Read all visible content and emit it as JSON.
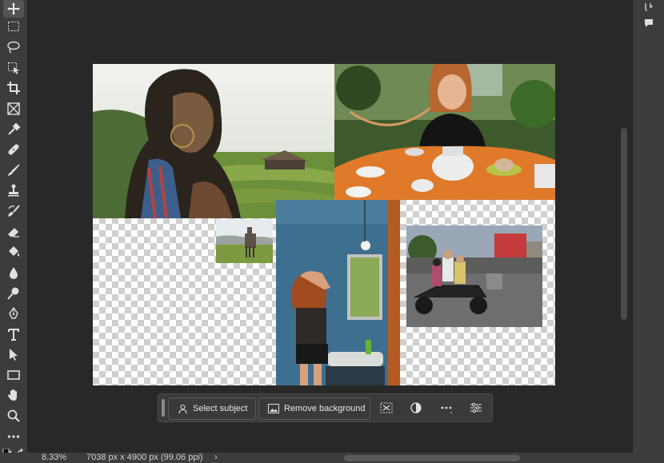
{
  "tools": [
    {
      "name": "move-tool",
      "icon": "move-icon",
      "active": true
    },
    {
      "name": "marquee-tool",
      "icon": "rectangular-marquee-icon"
    },
    {
      "name": "lasso-tool",
      "icon": "lasso-icon"
    },
    {
      "name": "object-selection-tool",
      "icon": "object-selection-icon"
    },
    {
      "name": "crop-tool",
      "icon": "crop-icon"
    },
    {
      "name": "frame-tool",
      "icon": "frame-icon"
    },
    {
      "name": "eyedropper-tool",
      "icon": "eyedropper-icon"
    },
    {
      "name": "healing-brush-tool",
      "icon": "bandage-icon"
    },
    {
      "name": "brush-tool",
      "icon": "brush-icon"
    },
    {
      "name": "clone-stamp-tool",
      "icon": "stamp-icon"
    },
    {
      "name": "history-brush-tool",
      "icon": "history-brush-icon"
    },
    {
      "name": "eraser-tool",
      "icon": "eraser-icon"
    },
    {
      "name": "paint-bucket-tool",
      "icon": "paint-bucket-icon"
    },
    {
      "name": "blur-tool",
      "icon": "drop-icon"
    },
    {
      "name": "dodge-tool",
      "icon": "dodge-icon"
    },
    {
      "name": "pen-tool",
      "icon": "pen-icon"
    },
    {
      "name": "type-tool",
      "icon": "type-icon"
    },
    {
      "name": "path-selection-tool",
      "icon": "arrow-icon"
    },
    {
      "name": "rectangle-tool",
      "icon": "rectangle-icon"
    },
    {
      "name": "hand-tool",
      "icon": "hand-icon"
    },
    {
      "name": "zoom-tool",
      "icon": "zoom-icon"
    },
    {
      "name": "more-tools",
      "icon": "more-icon"
    }
  ],
  "context_bar": {
    "select_subject": "Select subject",
    "remove_background": "Remove background"
  },
  "status": {
    "zoom": "8.33%",
    "doc_info": "7038 px x 4900 px (99.06 ppi)",
    "arrow": "›"
  },
  "colors": {
    "ui_background": "#282828",
    "panel": "#3c3c3c",
    "transparency_checker": "#cfcfcf",
    "photo_orange_tablecloth": "#e07a2a",
    "photo_blue_wall": "#3f6f8f"
  }
}
